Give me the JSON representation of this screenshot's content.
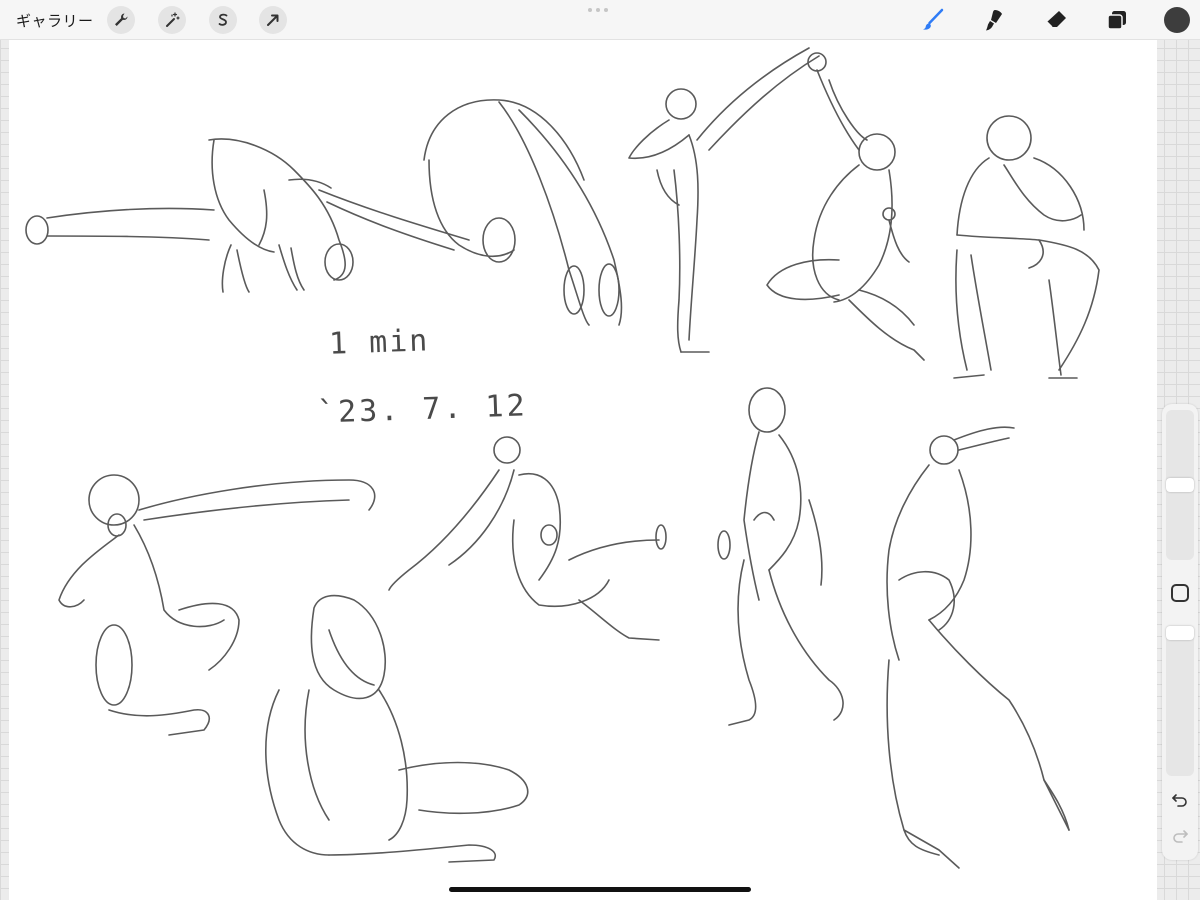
{
  "toolbar": {
    "gallery_label": "ギャラリー",
    "left_tools": [
      {
        "name": "actions",
        "icon": "wrench-icon"
      },
      {
        "name": "adjustments",
        "icon": "magic-wand-icon"
      },
      {
        "name": "selection",
        "icon": "selection-s-icon"
      },
      {
        "name": "transform",
        "icon": "arrow-icon"
      }
    ],
    "right_tools": [
      {
        "name": "brush",
        "icon": "brush-icon",
        "active": true
      },
      {
        "name": "smudge",
        "icon": "smudge-icon"
      },
      {
        "name": "eraser",
        "icon": "eraser-icon"
      },
      {
        "name": "layers",
        "icon": "layers-icon"
      }
    ],
    "active_color": "#3d3d3d",
    "accent_color": "#2f7cf6"
  },
  "canvas": {
    "annotations": {
      "duration": "1 min",
      "date": "`23. 7. 12"
    },
    "sketch_count": 10
  },
  "sidebar": {
    "brush_size_level": 0.5,
    "opacity_level": 0.0,
    "undo_icon": "undo-icon",
    "redo_icon": "redo-icon"
  }
}
